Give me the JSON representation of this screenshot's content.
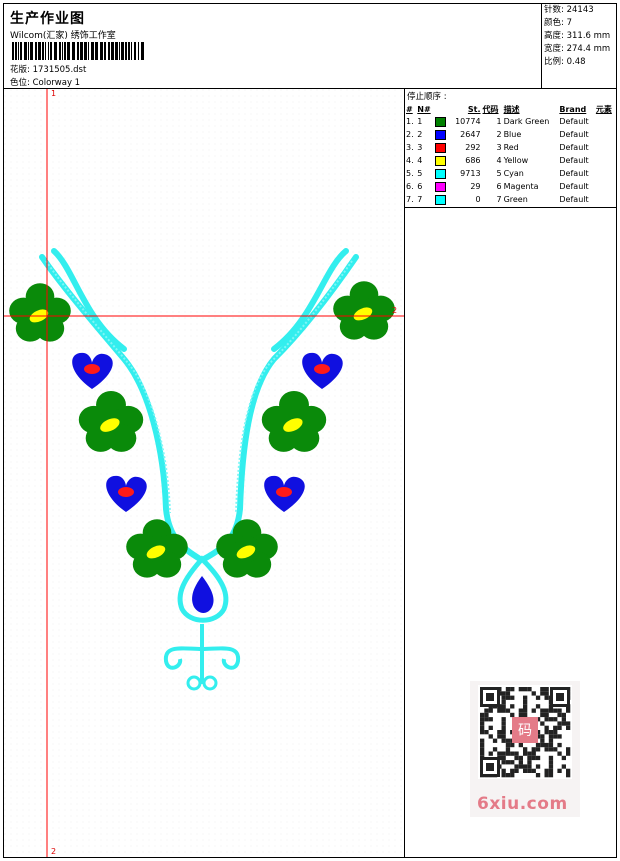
{
  "header": {
    "title": "生产作业图",
    "studio": "Wilcom(汇家) 绣饰工作室",
    "design_label": "花版",
    "design_value": "1731505.dst",
    "colorway_label": "色位",
    "colorway_value": "Colorway 1"
  },
  "stats": {
    "stitches_label": "针数",
    "stitches_value": "24143",
    "colors_label": "颜色",
    "colors_value": "7",
    "height_label": "高度",
    "height_value": "311.6 mm",
    "width_label": "宽度",
    "width_value": "274.4 mm",
    "scale_label": "比例",
    "scale_value": "0.48"
  },
  "legend": {
    "title": "停止顺序 :",
    "headers": [
      "#",
      "N#",
      "St.",
      "代码",
      "描述",
      "Brand",
      "元素"
    ],
    "rows": [
      {
        "idx": "1.",
        "n": "1",
        "color": "#008000",
        "st": "10774",
        "code": "1",
        "desc": "Dark Green",
        "brand": "Default"
      },
      {
        "idx": "2.",
        "n": "2",
        "color": "#0000ff",
        "st": "2647",
        "code": "2",
        "desc": "Blue",
        "brand": "Default"
      },
      {
        "idx": "3.",
        "n": "3",
        "color": "#ff0000",
        "st": "292",
        "code": "3",
        "desc": "Red",
        "brand": "Default"
      },
      {
        "idx": "4.",
        "n": "4",
        "color": "#ffff00",
        "st": "686",
        "code": "4",
        "desc": "Yellow",
        "brand": "Default"
      },
      {
        "idx": "5.",
        "n": "5",
        "color": "#00ffff",
        "st": "9713",
        "code": "5",
        "desc": "Cyan",
        "brand": "Default"
      },
      {
        "idx": "6.",
        "n": "6",
        "color": "#ff00ff",
        "st": "29",
        "code": "6",
        "desc": "Magenta",
        "brand": "Default"
      },
      {
        "idx": "7.",
        "n": "7",
        "color": "#00ffff",
        "st": "0",
        "code": "7",
        "desc": "Green",
        "brand": "Default"
      }
    ]
  },
  "canvas": {
    "marker_top": "1",
    "marker_right": "2",
    "marker_bottom": "2",
    "guide_color": "#ff0000",
    "fill_colors": {
      "green": "#0a8a0a",
      "blue": "#1010e0",
      "red": "#ff1a1a",
      "yellow": "#ffff00",
      "cyan": "#33eeee"
    }
  },
  "watermark": {
    "text": "6xiu.com",
    "seal_text": "码"
  }
}
